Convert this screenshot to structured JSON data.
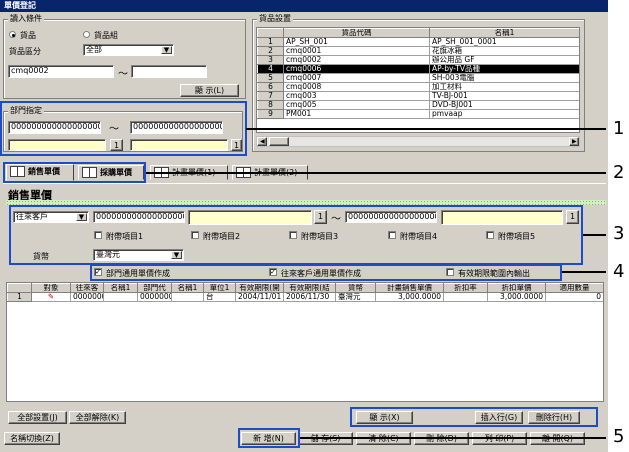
{
  "window": {
    "title": "單價登記"
  },
  "input_conditions": {
    "label": "讀入條件",
    "radio_product": "貨品",
    "radio_group": "貨品組",
    "selected": "product",
    "category_label": "貨品區分",
    "category_value": "全部",
    "from_value": "cmq0002",
    "to_value": "",
    "tilde": "～",
    "display_button": "顯 示(L)"
  },
  "department": {
    "label": "部門指定",
    "from_code": "000000000000000000",
    "to_code": "000000000000000000",
    "from_name": "",
    "to_name": "",
    "lookup": "1",
    "tilde": "～"
  },
  "product_settings": {
    "label": "貨品設置",
    "columns": [
      "",
      "貨品代碼",
      "名稱1"
    ],
    "rows": [
      {
        "no": "1",
        "code": "AP_SH_001",
        "name": "AP_SH_001_0001"
      },
      {
        "no": "2",
        "code": "cmq0001",
        "name": "花旗冰箱"
      },
      {
        "no": "3",
        "code": "cmq0002",
        "name": "辦公用品 GF"
      },
      {
        "no": "4",
        "code": "cmq0006",
        "name": "AP-by-TV品種"
      },
      {
        "no": "5",
        "code": "cmq0007",
        "name": "SH-003電腦"
      },
      {
        "no": "6",
        "code": "cmq0008",
        "name": "加工材料"
      },
      {
        "no": "7",
        "code": "cmq003",
        "name": "TV-BJ-001"
      },
      {
        "no": "8",
        "code": "cmq005",
        "name": "DVD-BJ001"
      },
      {
        "no": "9",
        "code": "PM001",
        "name": "pmvaap"
      }
    ],
    "selected_row": 3
  },
  "tabs": [
    {
      "label": "銷售單價",
      "active": true
    },
    {
      "label": "採購單價",
      "active": false
    },
    {
      "label": "計畫單價(1)",
      "active": false
    },
    {
      "label": "計畫單價(2)",
      "active": false
    }
  ],
  "section_title": "銷售單價",
  "filters": {
    "type_value": "往來客戶",
    "code_from": "000000000000000000",
    "code_to": "000000000000000000",
    "lookup": "1",
    "tilde": "～",
    "items": [
      "附帶項目1",
      "附帶項目2",
      "附帶項目3",
      "附帶項目4",
      "附帶項目5"
    ],
    "currency_label": "貨幣",
    "currency_value": "臺灣元"
  },
  "options": {
    "dept_common": "部門通用單價作成",
    "customer_common": "往來客戶通用單價作成",
    "valid_range_output": "有效期限範圍內輸出"
  },
  "price_table": {
    "columns": [
      "對象",
      "往來客",
      "名稱1",
      "部門代",
      "名稱1",
      "單位1",
      "有效期限(開",
      "有效期限(結",
      "貨幣",
      "計畫銷售單價",
      "折扣率",
      "折扣單價",
      "適用數量"
    ],
    "rows": [
      {
        "no": "1",
        "target": "",
        "customer": "0000000",
        "name1": "",
        "dept": "0000000",
        "name2": "",
        "unit": "台",
        "start": "2004/11/01",
        "end": "2006/11/30",
        "currency": "臺灣元",
        "price": "3,000.0000",
        "rate": "",
        "discount_price": "3,000.0000",
        "qty": "0"
      }
    ]
  },
  "buttons": {
    "select_all": "全部設置(J)",
    "clear_all": "全部解除(K)",
    "display": "顯 示(X)",
    "insert_row": "插入行(G)",
    "delete_row": "刪除行(H)",
    "name_switch": "名稱切換(Z)",
    "new": "新 增(N)",
    "save": "儲 存(S)",
    "clear": "清 除(C)",
    "delete": "刪 除(D)",
    "print": "列 印(P)",
    "close": "離 開(Q)"
  },
  "callouts": [
    "1",
    "2",
    "3",
    "4",
    "5"
  ]
}
